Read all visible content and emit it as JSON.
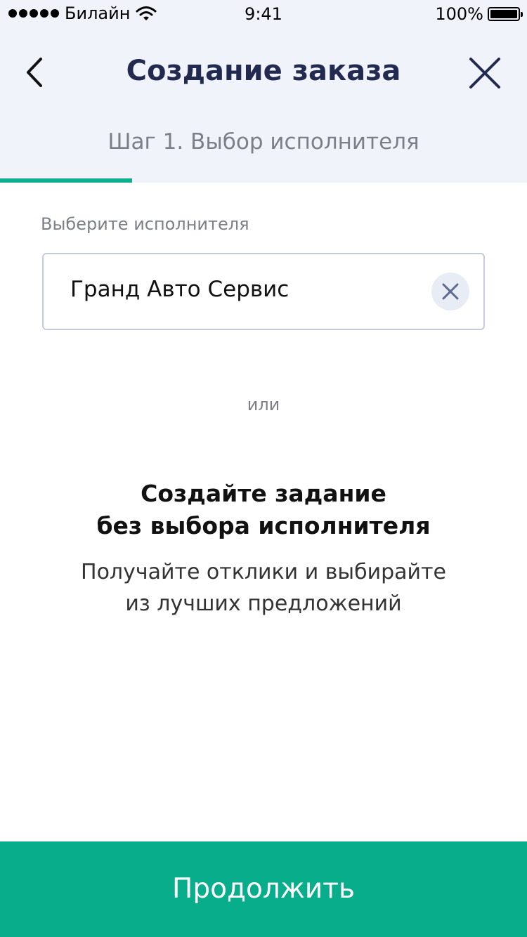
{
  "status_bar": {
    "carrier": "Билайн",
    "time": "9:41",
    "battery": "100%"
  },
  "header": {
    "title": "Создание заказа",
    "step": "Шаг 1. Выбор исполнителя",
    "progress": 0.25,
    "back_icon": "chevron-left-icon",
    "close_icon": "close-icon"
  },
  "executor": {
    "label": "Выберите исполнителя",
    "value": "Гранд Авто Сервис",
    "clear_icon": "clear-icon"
  },
  "or_text": "или",
  "promo": {
    "title_line1": "Создайте задание",
    "title_line2": "без выбора исполнителя",
    "text_line1": "Получайте отклики и выбирайте",
    "text_line2": "из лучших предложений"
  },
  "continue_label": "Продолжить",
  "colors": {
    "accent": "#08ad8c",
    "title": "#232a4f",
    "header_bg": "#f0f3f9"
  }
}
